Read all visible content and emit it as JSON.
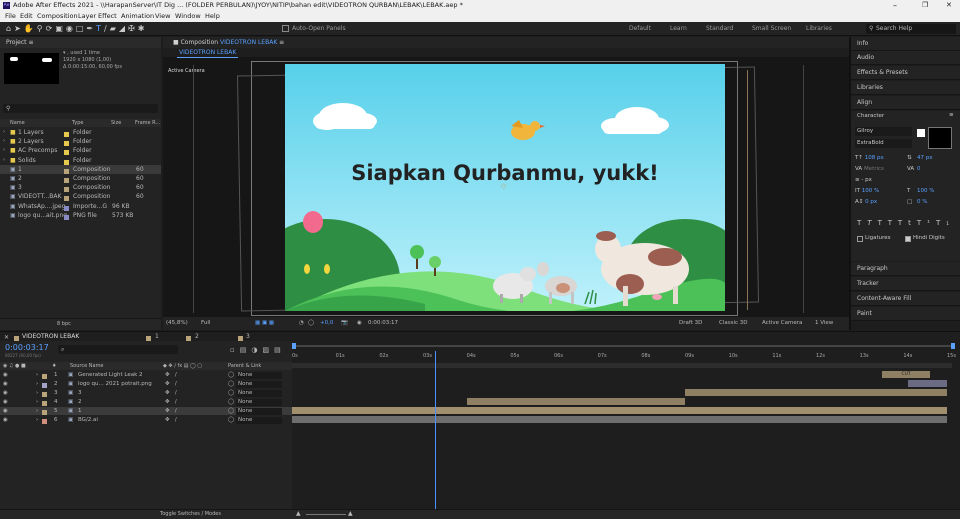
{
  "title": "Adobe After Effects 2021 - \\\\HarapanServer\\IT Dig ... (FOLDER PERBULAN)\\JYOY\\NITIP\\bahan edit\\VIDEOTRON QURBAN\\LEBAK\\LEBAK.aep *",
  "app_icon": "Ae",
  "menu": [
    "File",
    "Edit",
    "Composition",
    "Layer",
    "Effect",
    "Animation",
    "View",
    "Window",
    "Help"
  ],
  "toolbar": {
    "auto_open": "Auto-Open Panels",
    "workspaces": [
      "Default",
      "Learn",
      "Standard",
      "Small Screen",
      "Libraries"
    ],
    "search_help": "Search Help"
  },
  "project": {
    "title": "Project",
    "preview_info": [
      "▾ , used 1 time",
      "1920 x 1080 (1,00)",
      "Δ 0:00:15:00, 60,00 fps"
    ],
    "columns": [
      "Name",
      "Type",
      "Size",
      "Frame R..."
    ],
    "items": [
      {
        "name": "1 Layers",
        "type": "Folder",
        "size": "",
        "fr": "",
        "color": "#e6c84f"
      },
      {
        "name": "2 Layers",
        "type": "Folder",
        "size": "",
        "fr": "",
        "color": "#e6c84f"
      },
      {
        "name": "AC Precomps",
        "type": "Folder",
        "size": "",
        "fr": "",
        "color": "#e6c84f"
      },
      {
        "name": "Solids",
        "type": "Folder",
        "size": "",
        "fr": "",
        "color": "#e6c84f"
      },
      {
        "name": "1",
        "type": "Composition",
        "size": "",
        "fr": "60",
        "color": "#b9a47a"
      },
      {
        "name": "2",
        "type": "Composition",
        "size": "",
        "fr": "60",
        "color": "#b9a47a"
      },
      {
        "name": "3",
        "type": "Composition",
        "size": "",
        "fr": "60",
        "color": "#b9a47a"
      },
      {
        "name": "VIDEOTT...BAK",
        "type": "Composition",
        "size": "",
        "fr": "60",
        "color": "#b9a47a"
      },
      {
        "name": "WhatsAp....jpeg",
        "type": "Importe...G",
        "size": "96 KB",
        "fr": "",
        "color": "#8a8ac4"
      },
      {
        "name": "logo qu...ait.png",
        "type": "PNG file",
        "size": "573 KB",
        "fr": "",
        "color": "#8a8ac4"
      }
    ],
    "bpc": "8 bpc"
  },
  "composition": {
    "panel_title": "Composition",
    "comp_name": "VIDEOTRON LEBAK",
    "tab": "VIDEOTRON LEBAK",
    "active_camera": "Active Camera",
    "headline": "Siapkan Qurbanmu, yukk!",
    "footer": {
      "zoom": "(45,8%)",
      "quality": "Full",
      "exposure": "+0,0",
      "timecode": "0:00:03:17",
      "renderer": "Draft 3D",
      "classic": "Classic 3D",
      "camera": "Active Camera",
      "views": "1 View"
    }
  },
  "right_panels": [
    "Info",
    "Audio",
    "Effects & Presets",
    "Libraries",
    "Align"
  ],
  "character": {
    "title": "Character",
    "font": "Gilroy",
    "style": "ExtraBold",
    "size": "108 px",
    "leading": "47 px",
    "kerning": "Metrics",
    "tracking": "0",
    "stroke": "- px",
    "vscale": "100 %",
    "hscale": "100 %",
    "baseline": "0 px",
    "tsume": "0 %",
    "styles": [
      "T",
      "T",
      "TT",
      "Tt",
      "T¹",
      "T₁"
    ],
    "ligatures": "Ligatures",
    "hindi": "Hindi Digits"
  },
  "right_panels_bottom": [
    "Paragraph",
    "Tracker",
    "Content-Aware Fill",
    "Paint"
  ],
  "timeline": {
    "tabs": [
      {
        "name": "VIDEOTRON LEBAK",
        "color": "#b9a47a"
      },
      {
        "name": "1",
        "color": "#b9a47a"
      },
      {
        "name": "2",
        "color": "#b9a47a"
      },
      {
        "name": "3",
        "color": "#b9a47a"
      }
    ],
    "timecode": "0:00:03:17",
    "timecode_sub": "00227 (60,00 fps)",
    "search_placeholder": "⌕",
    "col_source": "Source Name",
    "col_parent": "Parent & Link",
    "layers": [
      {
        "num": "1",
        "name": "Generated Light Leak 2",
        "color": "#b9a47a",
        "parent": "None"
      },
      {
        "num": "2",
        "name": "logo qu... 2021 potrait.png",
        "color": "#a3a3c8",
        "parent": "None"
      },
      {
        "num": "3",
        "name": "3",
        "color": "#b9a47a",
        "parent": "None"
      },
      {
        "num": "4",
        "name": "2",
        "color": "#b9a47a",
        "parent": "None"
      },
      {
        "num": "5",
        "name": "1",
        "color": "#b9a47a",
        "parent": "None"
      },
      {
        "num": "6",
        "name": "BG/2.ai",
        "color": "#d08f7c",
        "parent": "None"
      }
    ],
    "ticks": [
      "0s",
      "01s",
      "02s",
      "03s",
      "04s",
      "05s",
      "06s",
      "07s",
      "08s",
      "09s",
      "10s",
      "11s",
      "12s",
      "13s",
      "14s",
      "15s"
    ],
    "playhead_sec": 3.28,
    "total_sec": 15,
    "clips": [
      {
        "start": 13.5,
        "end": 14.6,
        "color": "#8f7f63",
        "label": "CUT"
      },
      {
        "start": 14.1,
        "end": 15.0,
        "color": "#6b6b84",
        "label": ""
      },
      {
        "start": 9.0,
        "end": 15.0,
        "color": "#8f7f63",
        "label": ""
      },
      {
        "start": 4.0,
        "end": 9.0,
        "color": "#8f7f63",
        "label": ""
      },
      {
        "start": 0.0,
        "end": 15.0,
        "color": "#a18f6d",
        "label": ""
      },
      {
        "start": 0.0,
        "end": 15.0,
        "color": "#6e6e6e",
        "label": ""
      }
    ],
    "toggle": "Toggle Switches / Modes"
  }
}
